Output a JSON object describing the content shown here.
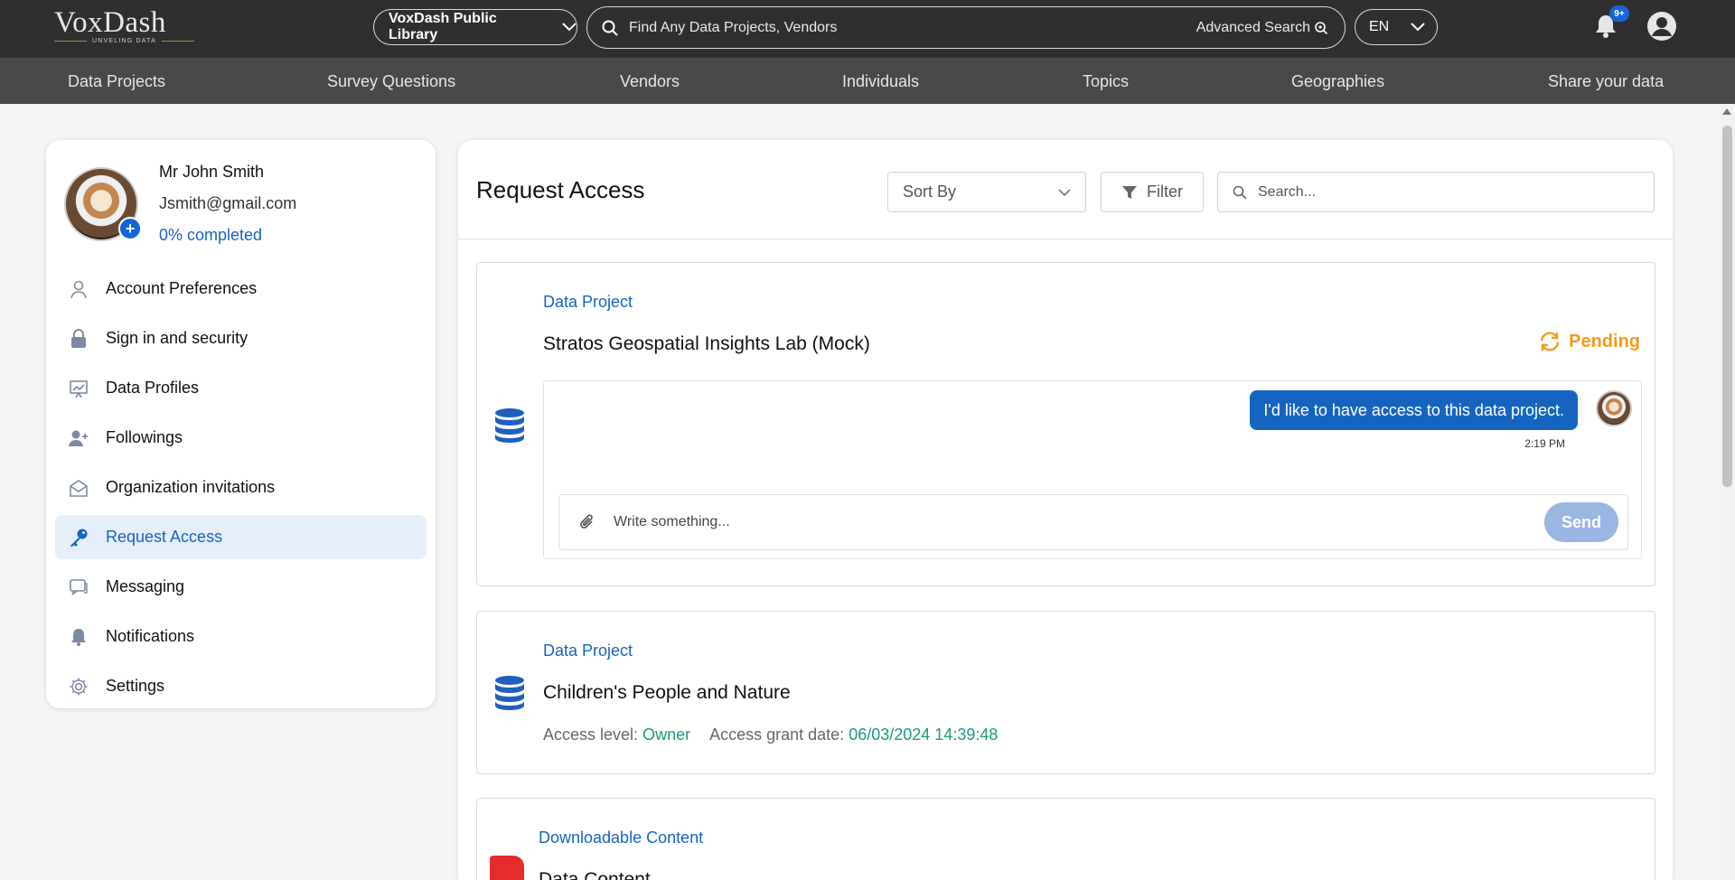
{
  "brand": {
    "name": "VoxDash",
    "tagline": "UNVELING DATA"
  },
  "header": {
    "library_select": "VoxDash Public Library",
    "search_placeholder": "Find Any Data Projects, Vendors",
    "advanced_search": "Advanced Search",
    "language": "EN",
    "notification_badge": "9+"
  },
  "nav": {
    "items": [
      "Data Projects",
      "Survey Questions",
      "Vendors",
      "Individuals",
      "Topics",
      "Geographies",
      "Share your data"
    ]
  },
  "profile": {
    "name": "Mr John Smith",
    "email": "Jsmith@gmail.com",
    "progress": "0% completed"
  },
  "sidebar": {
    "items": [
      {
        "label": "Account Preferences",
        "icon": "user-icon"
      },
      {
        "label": "Sign in and security",
        "icon": "lock-icon"
      },
      {
        "label": "Data Profiles",
        "icon": "chart-icon"
      },
      {
        "label": "Followings",
        "icon": "user-plus-icon"
      },
      {
        "label": "Organization invitations",
        "icon": "mail-open-icon"
      },
      {
        "label": "Request Access",
        "icon": "key-icon",
        "active": true
      },
      {
        "label": "Messaging",
        "icon": "chat-icon"
      },
      {
        "label": "Notifications",
        "icon": "bell-icon"
      },
      {
        "label": "Settings",
        "icon": "gear-icon"
      }
    ]
  },
  "main": {
    "title": "Request Access",
    "sort_by": "Sort By",
    "filter": "Filter",
    "search_placeholder": "Search..."
  },
  "requests": [
    {
      "type": "Data Project",
      "title": "Stratos Geospatial Insights Lab (Mock)",
      "status": "Pending",
      "message": "I'd like to have access to this data project.",
      "message_time": "2:19 PM",
      "composer_placeholder": "Write something...",
      "send_label": "Send"
    },
    {
      "type": "Data Project",
      "title": "Children's People and Nature",
      "access_level_label": "Access level:",
      "access_level": "Owner",
      "grant_date_label": "Access grant date:",
      "grant_date": "06/03/2024 14:39:48"
    },
    {
      "type": "Downloadable Content",
      "title": "Data Content"
    }
  ],
  "colors": {
    "accent": "#1565c0",
    "pending": "#f39a1b",
    "access_value": "#1a9a80",
    "topbar": "#2f2f2f",
    "navbar": "#494949"
  }
}
